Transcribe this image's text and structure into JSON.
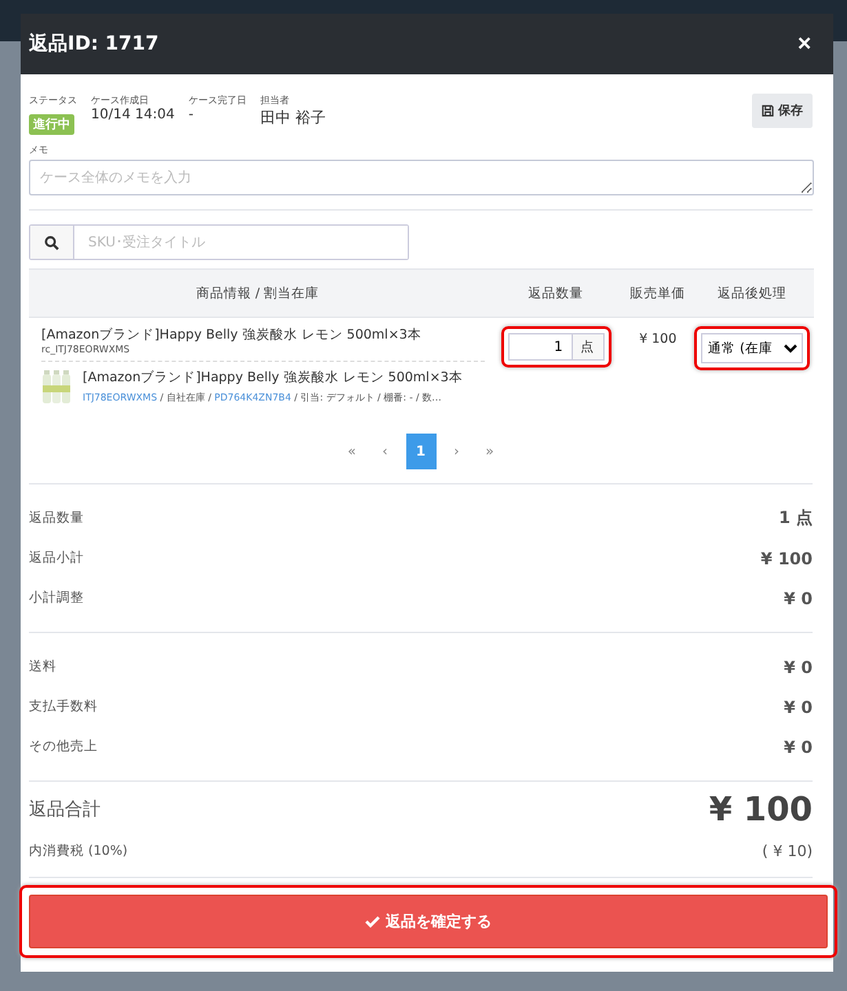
{
  "dialog": {
    "title": "返品ID: 1717",
    "close": "×"
  },
  "info": [
    {
      "label": "ステータス",
      "value": "進行中",
      "kind": "badge"
    },
    {
      "label": "ケース作成日",
      "value": "10/14 14:04",
      "kind": "text"
    },
    {
      "label": "ケース完了日",
      "value": "-",
      "kind": "text"
    },
    {
      "label": "担当者",
      "value": "田中 裕子",
      "kind": "large"
    }
  ],
  "save_button": "保存",
  "memo": {
    "label": "メモ",
    "placeholder": "ケース全体のメモを入力"
  },
  "search": {
    "placeholder": "SKU･受注タイトル"
  },
  "table": {
    "columns": [
      "商品情報 / 割当在庫",
      "返品数量",
      "販売単価",
      "返品後処理"
    ],
    "rows": [
      {
        "title": "[Amazonブランド]Happy Belly 強炭酸水 レモン 500ml×3本",
        "code": "rc_ITJ78EORWXMS",
        "stock_title": "[Amazonブランド]Happy Belly 強炭酸水 レモン 500ml×3本",
        "stock_meta": [
          {
            "text": "ITJ78EORWXMS",
            "kind": "link"
          },
          {
            "text": " / 自社在庫 / ",
            "kind": "text"
          },
          {
            "text": "PD764K4ZN7B4",
            "kind": "link"
          },
          {
            "text": " / 引当: デフォルト / 棚番: - / 数…",
            "kind": "text"
          }
        ],
        "quantity": "1",
        "unit": "点",
        "quantity_highlighted": true,
        "price": "¥ 100",
        "handling": "通常 (在庫",
        "handling_highlighted": true
      }
    ]
  },
  "pagination": [
    {
      "label": "«",
      "selected": false
    },
    {
      "label": "‹",
      "selected": false
    },
    {
      "label": "1",
      "selected": true
    },
    {
      "label": "›",
      "selected": false
    },
    {
      "label": "»",
      "selected": false
    }
  ],
  "summary_groups": [
    [
      {
        "label": "返品数量",
        "value": "1 点"
      },
      {
        "label": "返品小計",
        "value": "¥ 100"
      },
      {
        "label": "小計調整",
        "value": "¥ 0"
      }
    ],
    [
      {
        "label": "送料",
        "value": "¥ 0"
      },
      {
        "label": "支払手数料",
        "value": "¥ 0"
      },
      {
        "label": "その他売上",
        "value": "¥ 0"
      }
    ]
  ],
  "total": {
    "label": "返品合計",
    "value": "¥ 100",
    "tax_label": "内消費税 (10%)",
    "tax_value": "( ¥ 10)"
  },
  "confirm_button": {
    "label": "返品を確定する",
    "highlighted": true
  }
}
